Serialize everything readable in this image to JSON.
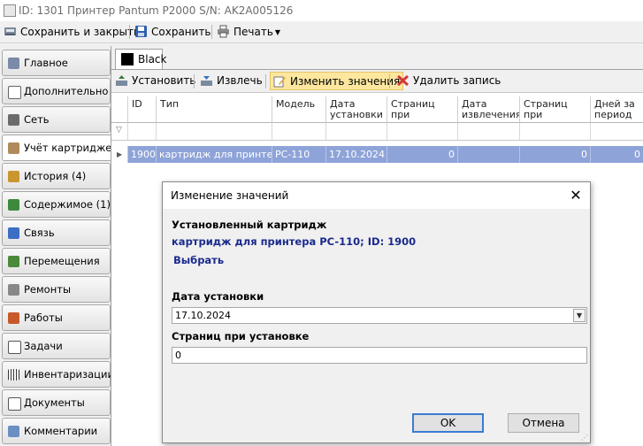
{
  "window": {
    "title": "ID: 1301  Принтер Pantum P2000 S/N: AK2A005126"
  },
  "toolbar": {
    "save_close": "Сохранить и закрыть",
    "save": "Сохранить",
    "print": "Печать"
  },
  "sidebar": {
    "items": [
      {
        "label": "Главное",
        "icon": "home-icon"
      },
      {
        "label": "Дополнительно",
        "icon": "list-icon"
      },
      {
        "label": "Сеть",
        "icon": "network-icon"
      },
      {
        "label": "Учёт картриджей",
        "icon": "cartridge-icon"
      },
      {
        "label": "История (4)",
        "icon": "history-icon"
      },
      {
        "label": "Содержимое (1)",
        "icon": "tree-icon"
      },
      {
        "label": "Связь",
        "icon": "link-icon"
      },
      {
        "label": "Перемещения",
        "icon": "truck-icon"
      },
      {
        "label": "Ремонты",
        "icon": "wrench-icon"
      },
      {
        "label": "Работы",
        "icon": "tools-icon"
      },
      {
        "label": "Задачи",
        "icon": "checklist-icon"
      },
      {
        "label": "Инвентаризации",
        "icon": "barcode-icon"
      },
      {
        "label": "Документы",
        "icon": "document-icon"
      },
      {
        "label": "Комментарии",
        "icon": "comment-icon"
      }
    ],
    "active_index": 3
  },
  "tab": {
    "label": "Black",
    "color": "#000000"
  },
  "grid_toolbar": {
    "install": "Установить",
    "extract": "Извлечь",
    "edit": "Изменить значения",
    "delete": "Удалить запись"
  },
  "table": {
    "headers": [
      "ID",
      "Тип",
      "Модель",
      "Дата установки",
      "Страниц при установке",
      "Дата извлечения",
      "Страниц при извлечении",
      "Дней за период"
    ],
    "rows": [
      [
        "1900",
        "картридж для принтера",
        "PC-110",
        "17.10.2024",
        "0",
        "",
        "0",
        "0"
      ]
    ]
  },
  "dialog": {
    "title": "Изменение значений",
    "installed_label": "Установленный картридж",
    "installed_value": "картридж для принтера PC-110; ID: 1900",
    "choose_link": "Выбрать",
    "date_label": "Дата установки",
    "date_value": "17.10.2024",
    "pages_label": "Страниц при установке",
    "pages_value": "0",
    "ok": "OK",
    "cancel": "Отмена"
  },
  "colors": {
    "selected_row": "#8ea3d8",
    "highlight_button": "#fde79f",
    "link_blue": "#1a2a8c"
  }
}
